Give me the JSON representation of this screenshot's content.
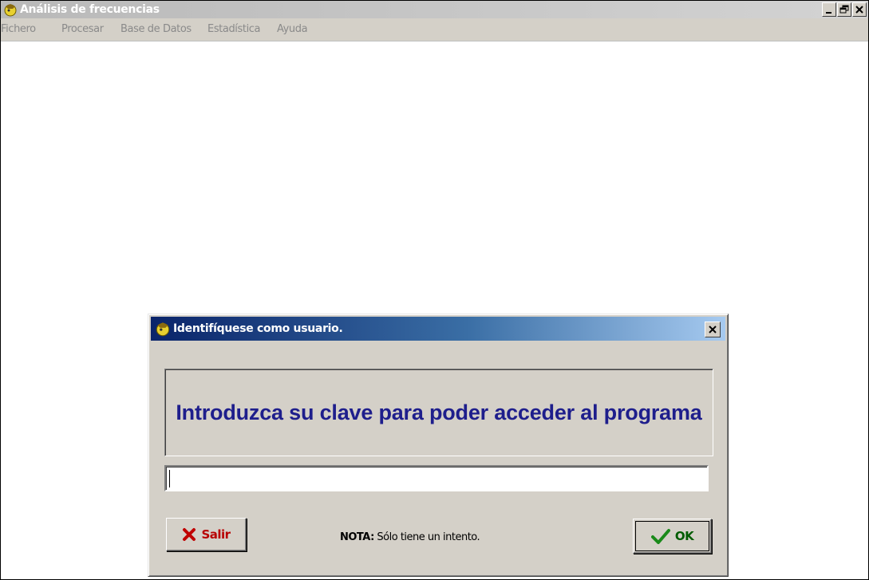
{
  "window": {
    "title": "Análisis de frecuencias",
    "controls": [
      "minimize-icon",
      "restore-icon",
      "close-icon"
    ]
  },
  "menu": {
    "items": [
      {
        "label": "Fichero"
      },
      {
        "label": "Procesar"
      },
      {
        "label": "Base de Datos"
      },
      {
        "label": "Estadística"
      },
      {
        "label": "Ayuda"
      }
    ]
  },
  "dialog": {
    "title": "Identifíquese como usuario.",
    "close_icon": "close-icon",
    "message": "Introduzca su clave para poder acceder al programa",
    "password": {
      "value": "",
      "placeholder": ""
    },
    "note_label": "NOTA:",
    "note_text": " Sólo tiene un intento.",
    "exit_button": {
      "label": "Salir",
      "icon": "x-icon",
      "color": "#b80000"
    },
    "ok_button": {
      "label": "OK",
      "icon": "checkmark-icon",
      "color": "#1a8a1a"
    }
  }
}
